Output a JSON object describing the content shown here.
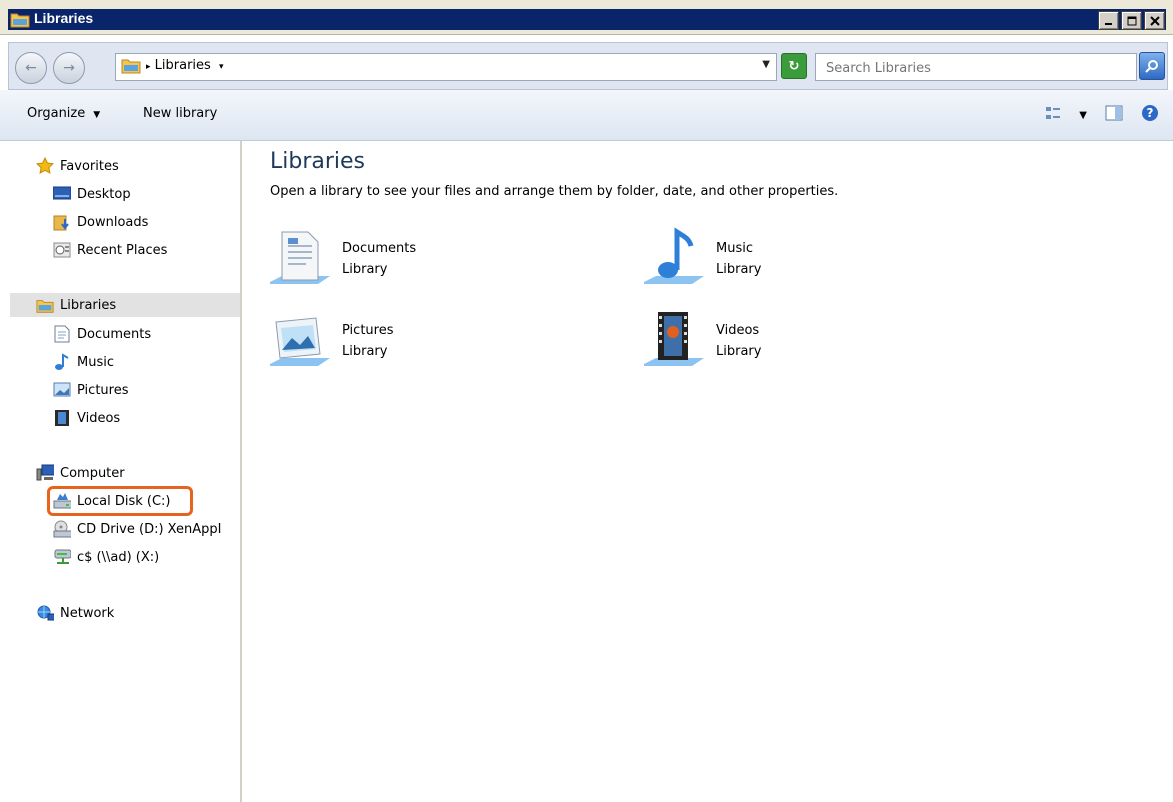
{
  "window": {
    "title": "Libraries",
    "controls": [
      "minimize",
      "maximize",
      "close"
    ]
  },
  "address": {
    "crumb": "Libraries",
    "search_placeholder": "Search Libraries"
  },
  "toolbar": {
    "organize_label": "Organize",
    "new_library_label": "New library"
  },
  "nav": {
    "favorites": {
      "label": "Favorites",
      "items": [
        "Desktop",
        "Downloads",
        "Recent Places"
      ]
    },
    "libraries": {
      "label": "Libraries",
      "items": [
        "Documents",
        "Music",
        "Pictures",
        "Videos"
      ]
    },
    "computer": {
      "label": "Computer",
      "items": [
        "Local Disk (C:)",
        "CD Drive (D:) XenAppI",
        "c$ (\\\\ad) (X:)"
      ]
    },
    "network": {
      "label": "Network"
    }
  },
  "main": {
    "heading": "Libraries",
    "subtitle": "Open a library to see your files and arrange them by folder, date, and other properties.",
    "libraries": [
      {
        "name": "Documents",
        "type": "Library",
        "icon": "documents-library-icon"
      },
      {
        "name": "Music",
        "type": "Library",
        "icon": "music-library-icon"
      },
      {
        "name": "Pictures",
        "type": "Library",
        "icon": "pictures-library-icon"
      },
      {
        "name": "Videos",
        "type": "Library",
        "icon": "videos-library-icon"
      }
    ]
  },
  "colors": {
    "titlebar": "#0a246a",
    "heading": "#1e395b",
    "highlight": "#e8641e",
    "selected_row": "#e2e2e2"
  }
}
